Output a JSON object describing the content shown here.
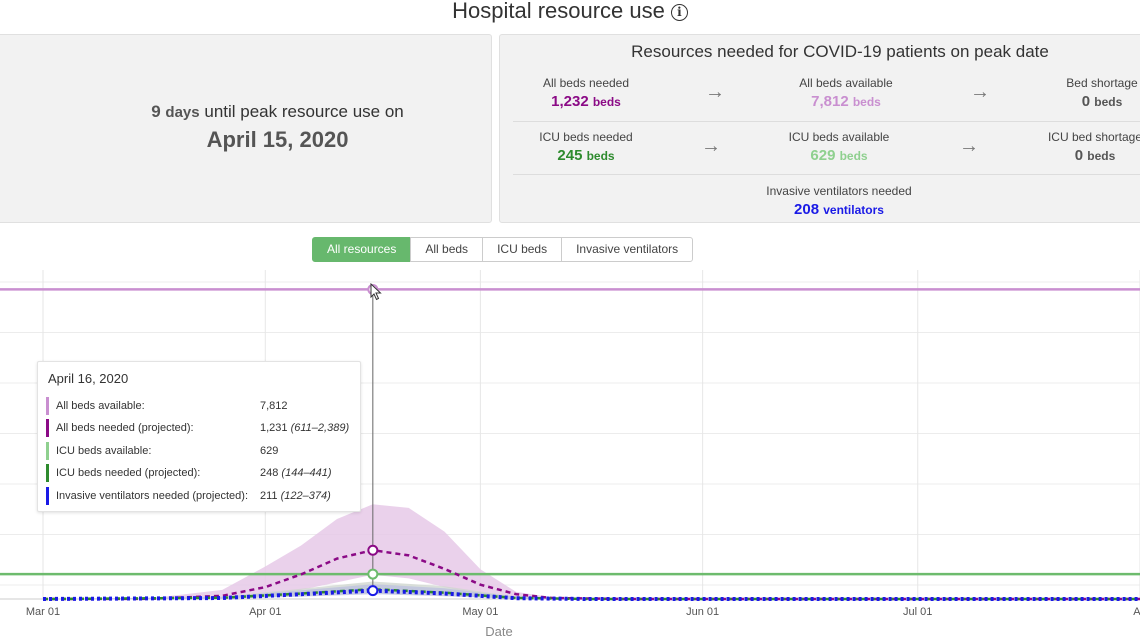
{
  "header": {
    "title": "Hospital resource use"
  },
  "peak": {
    "days": "9",
    "days_unit": "days",
    "line_text": "until peak resource use on",
    "date": "April 15, 2020"
  },
  "resources": {
    "title": "Resources needed for COVID-19 patients on peak date",
    "all_beds_needed": {
      "label": "All beds needed",
      "value": "1,232",
      "unit": "beds"
    },
    "all_beds_available": {
      "label": "All beds available",
      "value": "7,812",
      "unit": "beds"
    },
    "bed_shortage": {
      "label": "Bed shortage",
      "value": "0",
      "unit": "beds"
    },
    "icu_beds_needed": {
      "label": "ICU beds needed",
      "value": "245",
      "unit": "beds"
    },
    "icu_beds_available": {
      "label": "ICU beds available",
      "value": "629",
      "unit": "beds"
    },
    "icu_bed_shortage": {
      "label": "ICU bed shortage",
      "value": "0",
      "unit": "beds"
    },
    "ventilators_needed": {
      "label": "Invasive ventilators needed",
      "value": "208",
      "unit": "ventilators"
    }
  },
  "tabs": {
    "all_resources": "All resources",
    "all_beds": "All beds",
    "icu_beds": "ICU beds",
    "ventilators": "Invasive ventilators"
  },
  "tooltip": {
    "date": "April 16, 2020",
    "rows": [
      {
        "label": "All beds available:",
        "value": "7,812",
        "range": ""
      },
      {
        "label": "All beds needed (projected):",
        "value": "1,231",
        "range": "(611–2,389)"
      },
      {
        "label": "ICU beds available:",
        "value": "629",
        "range": ""
      },
      {
        "label": "ICU beds needed (projected):",
        "value": "248",
        "range": "(144–441)"
      },
      {
        "label": "Invasive ventilators needed (projected):",
        "value": "211",
        "range": "(122–374)"
      }
    ]
  },
  "colors": {
    "all_beds_available": "#c98fd0",
    "all_beds_needed": "#8b0a86",
    "all_beds_band": "#e6c9e8",
    "icu_beds_available": "#8fd08f",
    "icu_beds_needed": "#2e8b2e",
    "icu_available_line": "#6dbb6d",
    "ventilators": "#1a1ae6",
    "accent": "#67b86d"
  },
  "chart_data": {
    "type": "line",
    "xlabel": "Date",
    "x_ticks": [
      "Mar 01",
      "Apr 01",
      "May 01",
      "Jun 01",
      "Jul 01",
      "Au"
    ],
    "x_range": [
      "2020-02-24",
      "2020-08-01"
    ],
    "y_range": [
      0,
      8000
    ],
    "grid": true,
    "series": [
      {
        "name": "All beds available",
        "style": "solid",
        "x": [
          "2020-02-24",
          "2020-08-01"
        ],
        "y": [
          7812,
          7812
        ]
      },
      {
        "name": "ICU beds available",
        "style": "solid",
        "x": [
          "2020-02-24",
          "2020-08-01"
        ],
        "y": [
          629,
          629
        ]
      },
      {
        "name": "All beds needed (projected)",
        "style": "dashed",
        "x": [
          "2020-03-01",
          "2020-03-16",
          "2020-03-26",
          "2020-04-01",
          "2020-04-06",
          "2020-04-11",
          "2020-04-16",
          "2020-04-21",
          "2020-04-26",
          "2020-05-01",
          "2020-05-06",
          "2020-05-11",
          "2020-05-21",
          "2020-06-01",
          "2020-07-01",
          "2020-08-01"
        ],
        "y": [
          0,
          5,
          80,
          300,
          620,
          1020,
          1231,
          1100,
          760,
          360,
          120,
          25,
          0,
          0,
          0,
          0
        ],
        "lower": [
          0,
          0,
          20,
          90,
          230,
          420,
          611,
          520,
          300,
          100,
          20,
          0,
          0,
          0,
          0,
          0
        ],
        "upper": [
          0,
          20,
          230,
          820,
          1350,
          2020,
          2389,
          2300,
          1700,
          750,
          180,
          40,
          0,
          0,
          0,
          0
        ]
      },
      {
        "name": "ICU beds needed (projected)",
        "style": "dashed",
        "x": [
          "2020-03-01",
          "2020-03-26",
          "2020-04-06",
          "2020-04-16",
          "2020-04-26",
          "2020-05-06",
          "2020-05-16",
          "2020-08-01"
        ],
        "y": [
          0,
          30,
          140,
          248,
          160,
          25,
          0,
          0
        ],
        "lower": [
          0,
          10,
          70,
          144,
          80,
          5,
          0,
          0
        ],
        "upper": [
          0,
          60,
          260,
          441,
          320,
          60,
          0,
          0
        ]
      },
      {
        "name": "Invasive ventilators needed (projected)",
        "style": "dotted",
        "x": [
          "2020-03-01",
          "2020-03-26",
          "2020-04-06",
          "2020-04-16",
          "2020-04-26",
          "2020-05-06",
          "2020-05-16",
          "2020-08-01"
        ],
        "y": [
          0,
          25,
          120,
          211,
          140,
          20,
          0,
          0
        ],
        "lower": [
          0,
          8,
          60,
          122,
          70,
          5,
          0,
          0
        ],
        "upper": [
          0,
          50,
          220,
          374,
          270,
          50,
          0,
          0
        ]
      }
    ],
    "hover": {
      "x": "2020-04-16"
    }
  }
}
